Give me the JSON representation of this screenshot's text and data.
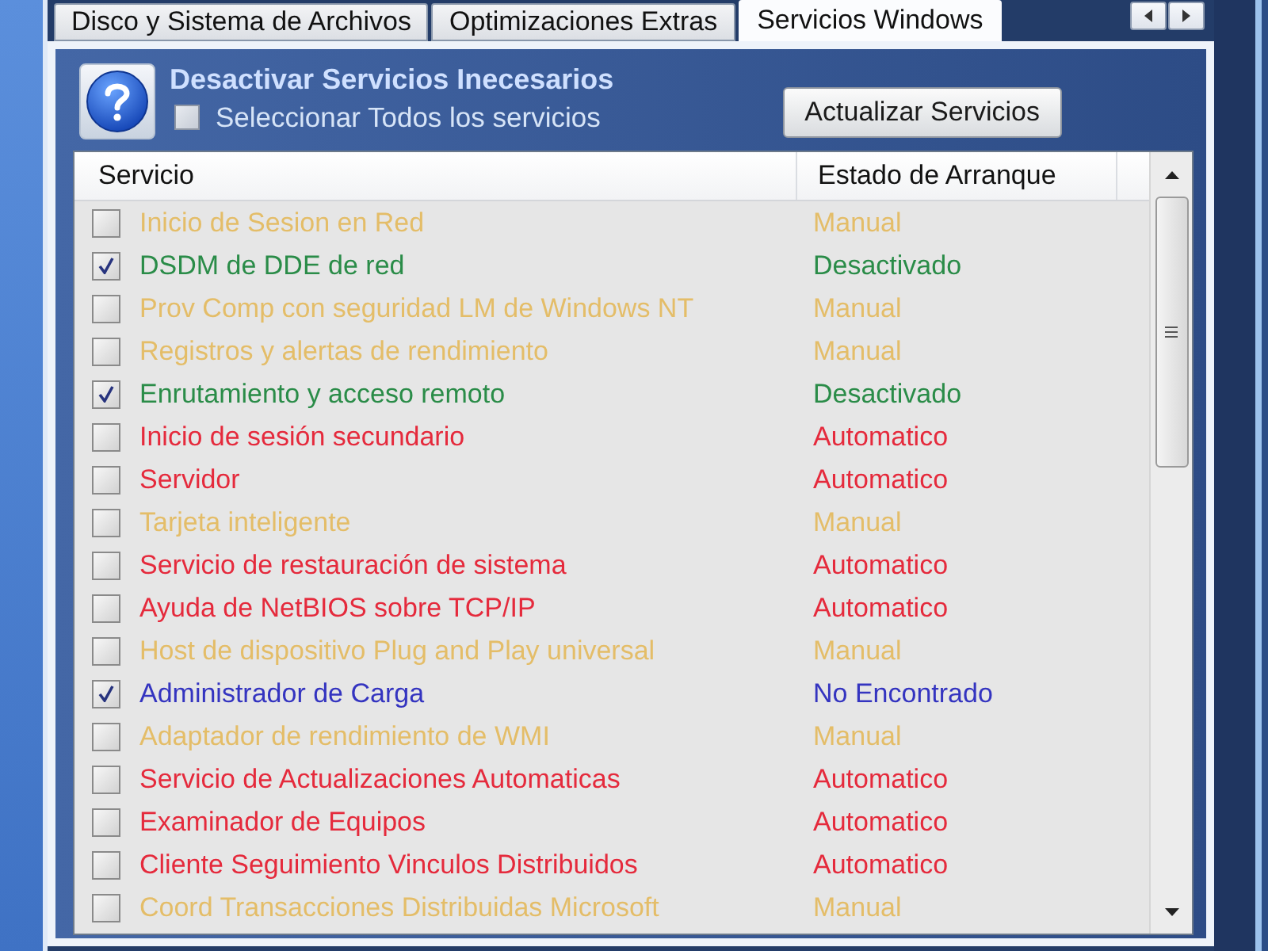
{
  "tabs": [
    {
      "label": "Disco y Sistema de Archivos",
      "selected": false
    },
    {
      "label": "Optimizaciones Extras",
      "selected": false
    },
    {
      "label": "Servicios Windows",
      "selected": true
    }
  ],
  "panel": {
    "title": "Desactivar Servicios Inecesarios",
    "select_all": {
      "label": "Seleccionar Todos los servicios",
      "checked": false
    },
    "refresh_button": "Actualizar Servicios"
  },
  "services": {
    "columns": [
      "Servicio",
      "Estado de Arranque"
    ],
    "rows": [
      {
        "name": "Inicio de Sesion en Red",
        "status": "Manual",
        "checked": false,
        "color": "#e4bd68"
      },
      {
        "name": "DSDM de DDE de red",
        "status": "Desactivado",
        "checked": true,
        "color": "#2a8c48"
      },
      {
        "name": "Prov Comp con seguridad LM de Windows NT",
        "status": "Manual",
        "checked": false,
        "color": "#e4bd68"
      },
      {
        "name": "Registros y alertas de rendimiento",
        "status": "Manual",
        "checked": false,
        "color": "#e4bd68"
      },
      {
        "name": "Enrutamiento y acceso remoto",
        "status": "Desactivado",
        "checked": true,
        "color": "#2a8c48"
      },
      {
        "name": "Inicio de sesión secundario",
        "status": "Automatico",
        "checked": false,
        "color": "#e52a3c"
      },
      {
        "name": "Servidor",
        "status": "Automatico",
        "checked": false,
        "color": "#e52a3c"
      },
      {
        "name": "Tarjeta inteligente",
        "status": "Manual",
        "checked": false,
        "color": "#e4bd68"
      },
      {
        "name": "Servicio de restauración de sistema",
        "status": "Automatico",
        "checked": false,
        "color": "#e52a3c"
      },
      {
        "name": "Ayuda de NetBIOS sobre TCP/IP",
        "status": "Automatico",
        "checked": false,
        "color": "#e52a3c"
      },
      {
        "name": "Host de dispositivo Plug and Play universal",
        "status": "Manual",
        "checked": false,
        "color": "#e4bd68"
      },
      {
        "name": "Administrador de Carga",
        "status": "No Encontrado",
        "checked": true,
        "color": "#3434c0"
      },
      {
        "name": "Adaptador de rendimiento de WMI",
        "status": "Manual",
        "checked": false,
        "color": "#e4bd68"
      },
      {
        "name": "Servicio de Actualizaciones Automaticas",
        "status": "Automatico",
        "checked": false,
        "color": "#e52a3c"
      },
      {
        "name": "Examinador de Equipos",
        "status": "Automatico",
        "checked": false,
        "color": "#e52a3c"
      },
      {
        "name": "Cliente Seguimiento Vinculos Distribuidos",
        "status": "Automatico",
        "checked": false,
        "color": "#e52a3c"
      },
      {
        "name": "Coord Transacciones Distribuidas Microsoft",
        "status": "Manual",
        "checked": false,
        "color": "#e4bd68"
      }
    ]
  }
}
